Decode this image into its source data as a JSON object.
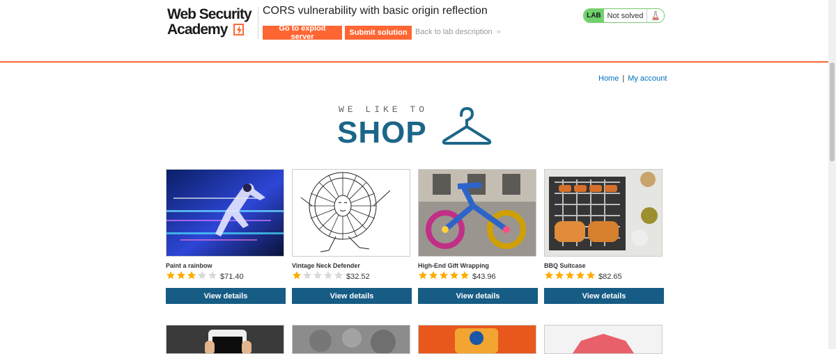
{
  "header": {
    "logo_line1": "Web Security",
    "logo_line2": "Academy",
    "lab_title": "CORS vulnerability with basic origin reflection",
    "exploit_button": "Go to exploit server",
    "solution_button": "Submit solution",
    "back_link": "Back to lab description",
    "back_chevron": "»",
    "status_badge": "LAB",
    "status_text": "Not solved"
  },
  "nav": {
    "home": "Home",
    "separator": "|",
    "account": "My account"
  },
  "shop_logo": {
    "small": "WE LIKE TO",
    "big": "SHOP"
  },
  "products": [
    {
      "name": "Paint a rainbow",
      "rating": 3,
      "price": "$71.40",
      "button": "View details"
    },
    {
      "name": "Vintage Neck Defender",
      "rating": 1,
      "price": "$32.52",
      "button": "View details"
    },
    {
      "name": "High-End Gift Wrapping",
      "rating": 5,
      "price": "$43.96",
      "button": "View details"
    },
    {
      "name": "BBQ Suitcase",
      "rating": 5,
      "price": "$82.65",
      "button": "View details"
    }
  ],
  "colors": {
    "accent": "#ff6633",
    "button": "#165c85",
    "link": "#0071bc",
    "star_on": "#ffad00",
    "star_off": "#d9d9d9"
  }
}
